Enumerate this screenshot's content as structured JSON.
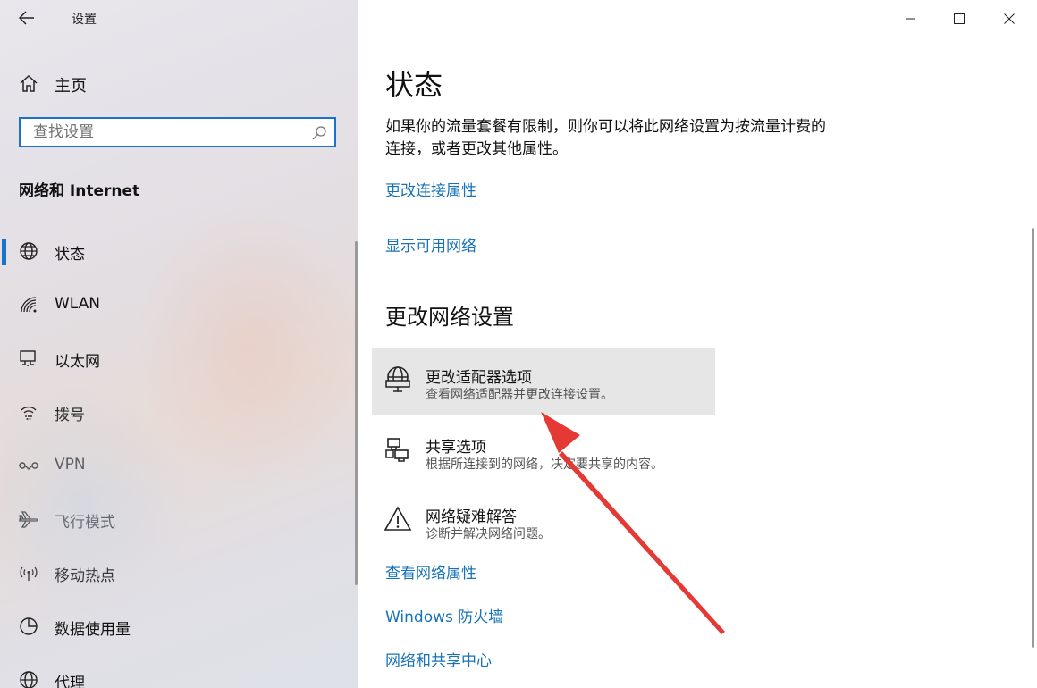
{
  "window": {
    "title": "设置"
  },
  "sidebar": {
    "home_label": "主页",
    "search_placeholder": "查找设置",
    "section_title": "网络和 Internet",
    "items": [
      {
        "label": "状态",
        "icon": "globe-icon",
        "active": true
      },
      {
        "label": "WLAN",
        "icon": "wifi-icon"
      },
      {
        "label": "以太网",
        "icon": "ethernet-icon"
      },
      {
        "label": "拨号",
        "icon": "dialup-icon"
      },
      {
        "label": "VPN",
        "icon": "vpn-icon"
      },
      {
        "label": "飞行模式",
        "icon": "airplane-icon"
      },
      {
        "label": "移动热点",
        "icon": "hotspot-icon"
      },
      {
        "label": "数据使用量",
        "icon": "data-usage-icon"
      },
      {
        "label": "代理",
        "icon": "globe-icon"
      }
    ]
  },
  "main": {
    "heading": "状态",
    "paragraph_line1": "如果你的流量套餐有限制，则你可以将此网络设置为按流量计费的",
    "paragraph_line2": "连接，或者更改其他属性。",
    "link_change_props": "更改连接属性",
    "link_show_networks": "显示可用网络",
    "section_heading": "更改网络设置",
    "options": [
      {
        "title": "更改适配器选项",
        "desc": "查看网络适配器并更改连接设置。",
        "icon": "adapter-globe-icon",
        "highlighted": true
      },
      {
        "title": "共享选项",
        "desc": "根据所连接到的网络，决定要共享的内容。",
        "icon": "sharing-icon"
      },
      {
        "title": "网络疑难解答",
        "desc": "诊断并解决网络问题。",
        "icon": "warning-icon"
      }
    ],
    "link_view_props": "查看网络属性",
    "link_firewall": "Windows 防火墙",
    "link_sharing_center": "网络和共享中心"
  },
  "colors": {
    "accent": "#1a73c8",
    "link": "#1673b8",
    "highlight": "#e6e6e6",
    "annotation_arrow": "#e53935"
  }
}
